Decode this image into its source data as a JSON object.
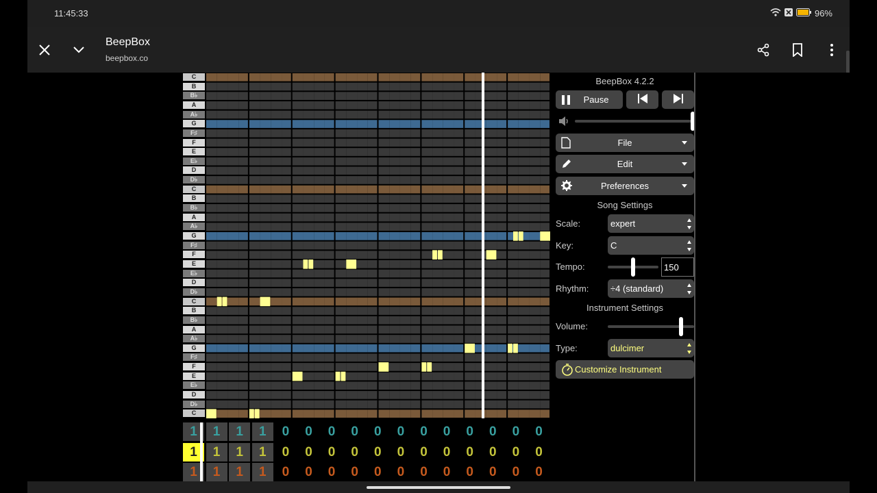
{
  "status_bar": {
    "time": "11:45:33",
    "battery": "96%",
    "wifi_icon": "wifi-icon",
    "battery_icon": "battery-icon"
  },
  "browser": {
    "title": "BeepBox",
    "url": "beepbox.co",
    "close_icon": "close-icon",
    "collapse_icon": "chevron-down-icon",
    "share_icon": "share-icon",
    "bookmark_icon": "bookmark-icon",
    "more_icon": "more-vert-icon"
  },
  "piano_keys": [
    "C",
    "B",
    "B♭",
    "A",
    "A♭",
    "G",
    "F♯",
    "F",
    "E",
    "E♭",
    "D",
    "D♭",
    "C",
    "B",
    "B♭",
    "A",
    "A♭",
    "G",
    "F♯",
    "F",
    "E",
    "E♭",
    "D",
    "D♭",
    "C",
    "B",
    "B♭",
    "A",
    "A♭",
    "G",
    "F♯",
    "F",
    "E",
    "E♭",
    "D",
    "D♭",
    "C"
  ],
  "pattern_notes": [
    {
      "bar": 7,
      "beat_start": 0.5,
      "beat_end": 1.0,
      "pitch_row": 17
    },
    {
      "bar": 7,
      "beat_start": 1.0,
      "beat_end": 1.5,
      "pitch_row": 17
    },
    {
      "bar": 7,
      "beat_start": 3.0,
      "beat_end": 4.0,
      "pitch_row": 17
    },
    {
      "bar": 6,
      "beat_start": 2.0,
      "beat_end": 3.0,
      "pitch_row": 19
    },
    {
      "bar": 5,
      "beat_start": 1.0,
      "beat_end": 1.5,
      "pitch_row": 19
    },
    {
      "bar": 5,
      "beat_start": 1.5,
      "beat_end": 2.0,
      "pitch_row": 19
    },
    {
      "bar": 2,
      "beat_start": 1.0,
      "beat_end": 1.5,
      "pitch_row": 20
    },
    {
      "bar": 2,
      "beat_start": 1.5,
      "beat_end": 2.0,
      "pitch_row": 20
    },
    {
      "bar": 3,
      "beat_start": 1.0,
      "beat_end": 2.0,
      "pitch_row": 20
    },
    {
      "bar": 0,
      "beat_start": 1.0,
      "beat_end": 1.5,
      "pitch_row": 24
    },
    {
      "bar": 0,
      "beat_start": 1.5,
      "beat_end": 2.0,
      "pitch_row": 24
    },
    {
      "bar": 1,
      "beat_start": 1.0,
      "beat_end": 2.0,
      "pitch_row": 24
    },
    {
      "bar": 6,
      "beat_start": 0.0,
      "beat_end": 1.0,
      "pitch_row": 29
    },
    {
      "bar": 7,
      "beat_start": 0.0,
      "beat_end": 0.5,
      "pitch_row": 29
    },
    {
      "bar": 7,
      "beat_start": 0.5,
      "beat_end": 1.0,
      "pitch_row": 29
    },
    {
      "bar": 4,
      "beat_start": 0.0,
      "beat_end": 1.0,
      "pitch_row": 31
    },
    {
      "bar": 5,
      "beat_start": 0.0,
      "beat_end": 0.5,
      "pitch_row": 31
    },
    {
      "bar": 5,
      "beat_start": 0.5,
      "beat_end": 1.0,
      "pitch_row": 31
    },
    {
      "bar": 2,
      "beat_start": 0.0,
      "beat_end": 1.0,
      "pitch_row": 32
    },
    {
      "bar": 3,
      "beat_start": 0.0,
      "beat_end": 0.5,
      "pitch_row": 32
    },
    {
      "bar": 3,
      "beat_start": 0.5,
      "beat_end": 1.0,
      "pitch_row": 32
    },
    {
      "bar": 0,
      "beat_start": 0.0,
      "beat_end": 1.0,
      "pitch_row": 36
    },
    {
      "bar": 1,
      "beat_start": 0.0,
      "beat_end": 0.5,
      "pitch_row": 36
    },
    {
      "bar": 1,
      "beat_start": 0.5,
      "beat_end": 1.0,
      "pitch_row": 36
    }
  ],
  "playhead_position_fraction": 0.803,
  "track_rows": [
    {
      "color": "#39a0a0",
      "values": [
        "1",
        "1",
        "1",
        "1",
        "0",
        "0",
        "0",
        "0",
        "0",
        "0",
        "0",
        "0",
        "0",
        "0",
        "0",
        "0"
      ]
    },
    {
      "color": "#c4c43a",
      "values": [
        "1",
        "1",
        "1",
        "1",
        "0",
        "0",
        "0",
        "0",
        "0",
        "0",
        "0",
        "0",
        "0",
        "0",
        "0",
        "0"
      ]
    },
    {
      "color": "#c65a1e",
      "values": [
        "1",
        "1",
        "1",
        "1",
        "0",
        "0",
        "0",
        "0",
        "0",
        "0",
        "0",
        "0",
        "0",
        "0",
        "0",
        "0"
      ]
    }
  ],
  "selected_track_cell_text": "1",
  "sidebar": {
    "version": "BeepBox 4.2.2",
    "pause_label": "Pause",
    "pause_icon": "pause-icon",
    "prev_icon": "skip-previous-icon",
    "next_icon": "skip-next-icon",
    "volume_icon": "volume-icon",
    "master_volume_fraction": 1.0,
    "file_label": "File",
    "edit_label": "Edit",
    "prefs_label": "Preferences",
    "song_settings": "Song Settings",
    "scale_label": "Scale:",
    "scale_value": "expert",
    "key_label": "Key:",
    "key_value": "C",
    "tempo_label": "Tempo:",
    "tempo_value": "150",
    "tempo_fraction": 0.5,
    "rhythm_label": "Rhythm:",
    "rhythm_value": "÷4 (standard)",
    "instrument_settings": "Instrument Settings",
    "volume_label": "Volume:",
    "instrument_volume_fraction": 0.85,
    "type_label": "Type:",
    "type_value": "dulcimer",
    "customize_label": "Customize Instrument",
    "customize_icon": "stopwatch-icon"
  },
  "colors": {
    "brown": "#7a5a3a",
    "blue": "#3e6a92",
    "note": "#ffff92",
    "cell": "#393939",
    "accent": "#ffff80"
  }
}
